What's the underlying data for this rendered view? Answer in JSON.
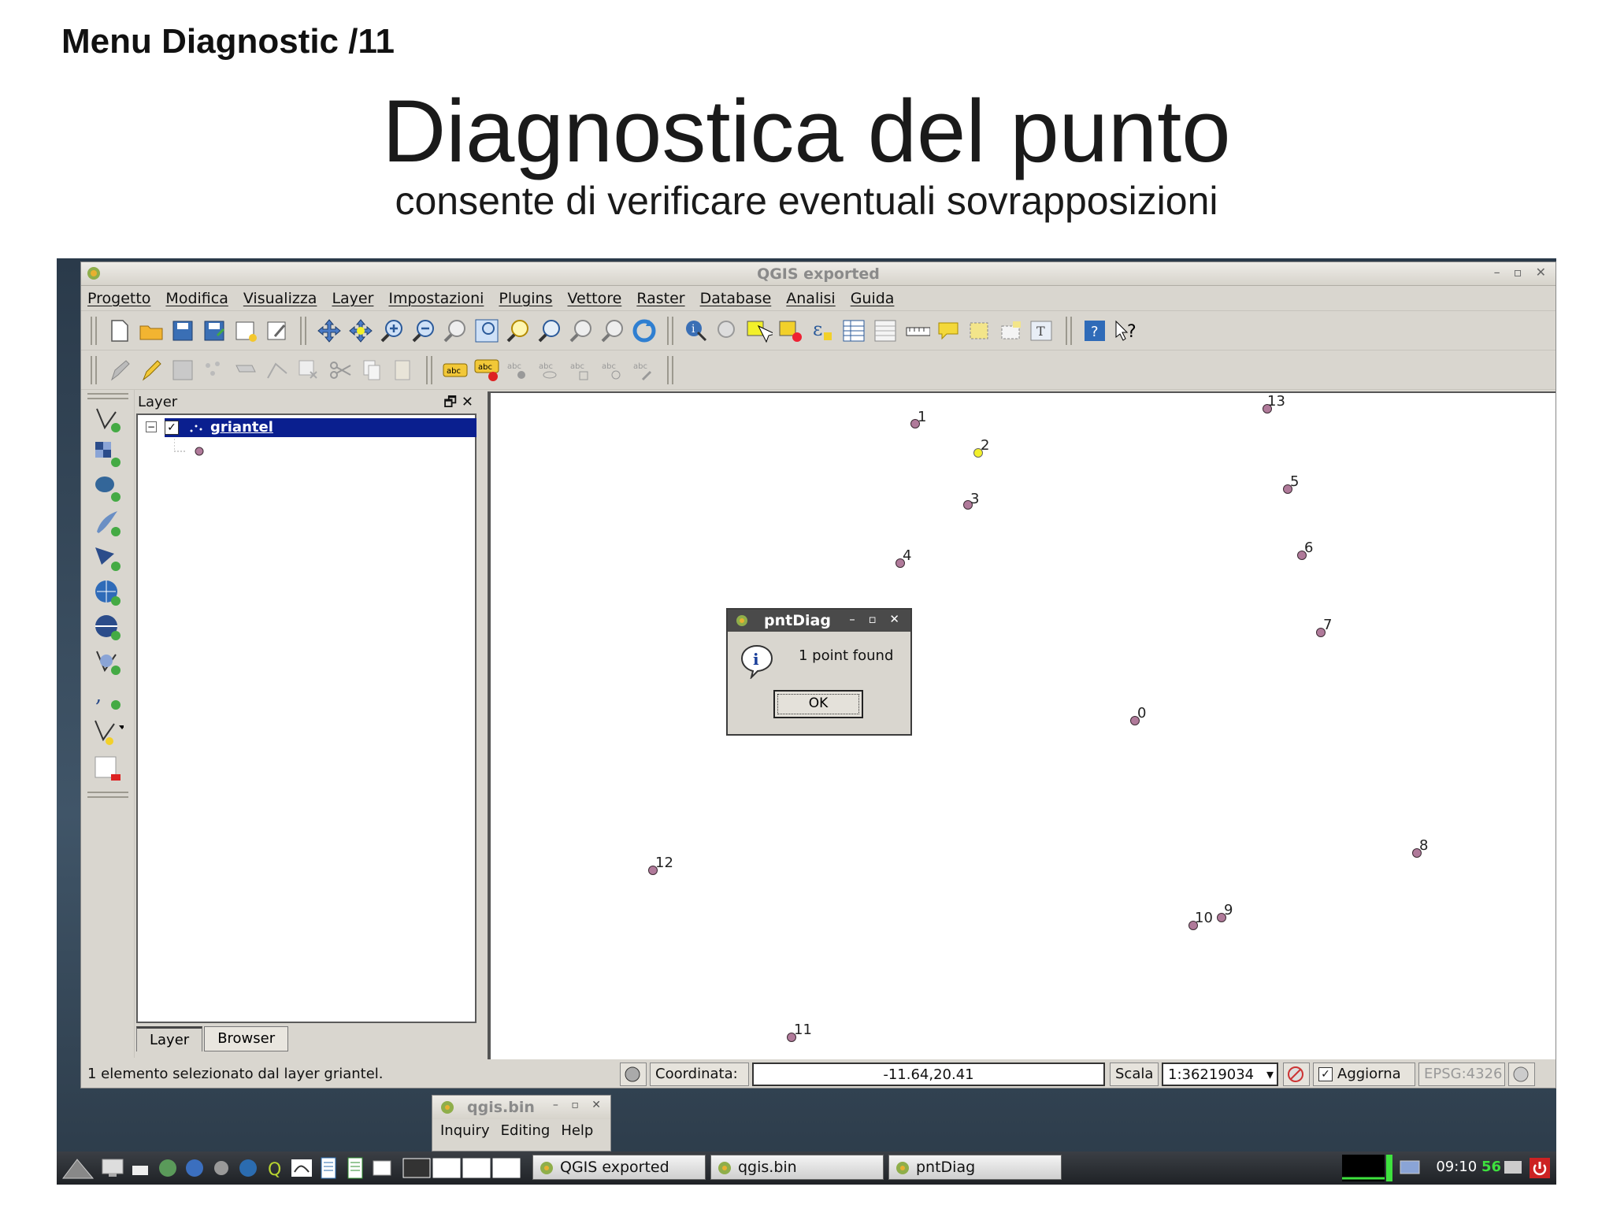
{
  "slide": {
    "header": "Menu Diagnostic /11",
    "title": "Diagnostica del punto",
    "subtitle": "consente di verificare eventuali sovrapposizioni"
  },
  "qgis": {
    "window_title": "QGIS exported",
    "menu": [
      "Progetto",
      "Modifica",
      "Visualizza",
      "Layer",
      "Impostazioni",
      "Plugins",
      "Vettore",
      "Raster",
      "Database",
      "Analisi",
      "Guida"
    ],
    "layer_panel": {
      "title": "Layer",
      "layer_name": "griantel",
      "checked": true,
      "tabs": [
        "Layer",
        "Browser"
      ]
    },
    "points": [
      {
        "label": "1"
      },
      {
        "label": "2",
        "selected": true
      },
      {
        "label": "3"
      },
      {
        "label": "4"
      },
      {
        "label": "13"
      },
      {
        "label": "5"
      },
      {
        "label": "6"
      },
      {
        "label": "7"
      },
      {
        "label": "0"
      },
      {
        "label": "12"
      },
      {
        "label": "8"
      },
      {
        "label": "9"
      },
      {
        "label": "10"
      },
      {
        "label": "11"
      }
    ],
    "dialog": {
      "title": "pntDiag",
      "message": "1 point found",
      "ok_label": "OK"
    },
    "statusbar": {
      "message": "1 elemento selezionato dal layer griantel.",
      "coord_label": "Coordinata:",
      "coord_value": "-11.64,20.41",
      "scale_label": "Scala",
      "scale_value": "1:36219034",
      "render_label": "Aggiorna",
      "render_checked": true,
      "crs": "EPSG:4326"
    }
  },
  "qgis_bin": {
    "title": "qgis.bin",
    "menu": [
      "Inquiry",
      "Editing",
      "Help"
    ]
  },
  "taskbar": {
    "apps": [
      "QGIS exported",
      "qgis.bin",
      "pntDiag"
    ],
    "clock": "09:10",
    "clock_seconds": "56"
  },
  "colors": {
    "selection": "#0a1f8f",
    "point_fill": "#b07a9a",
    "selected_point_fill": "#f2f02a"
  }
}
